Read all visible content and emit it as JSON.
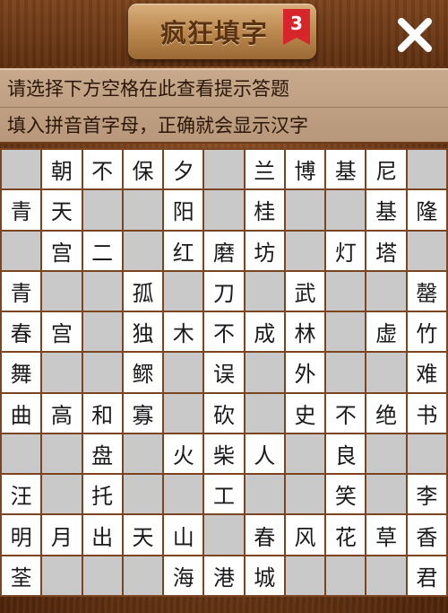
{
  "header": {
    "title": "疯狂填字",
    "level": "3",
    "close_icon": "close-icon"
  },
  "hints": {
    "line1": "请选择下方空格在此查看提示答题",
    "line2": "填入拼音首字母，正确就会显示汉字"
  },
  "colors": {
    "blocked_cell": "#c9c9c9",
    "open_cell": "#ffffff",
    "badge": "#d6262b"
  },
  "grid": {
    "note": "# = blocked, empty string = empty answer cell",
    "rows": [
      [
        "#",
        "朝",
        "不",
        "保",
        "夕",
        "#",
        "兰",
        "博",
        "基",
        "尼",
        "#"
      ],
      [
        "青",
        "天",
        "#",
        "#",
        "阳",
        "#",
        "桂",
        "#",
        "#",
        "基",
        "隆"
      ],
      [
        "#",
        "宫",
        "二",
        "#",
        "红",
        "磨",
        "坊",
        "#",
        "灯",
        "塔",
        "#"
      ],
      [
        "青",
        "#",
        "#",
        "孤",
        "#",
        "刀",
        "#",
        "武",
        "#",
        "#",
        "罄"
      ],
      [
        "春",
        "宫",
        "#",
        "独",
        "木",
        "不",
        "成",
        "林",
        "#",
        "虚",
        "竹"
      ],
      [
        "舞",
        "#",
        "#",
        "鳏",
        "#",
        "误",
        "#",
        "外",
        "#",
        "#",
        "难"
      ],
      [
        "曲",
        "高",
        "和",
        "寡",
        "#",
        "砍",
        "#",
        "史",
        "不",
        "绝",
        "书"
      ],
      [
        "#",
        "#",
        "盘",
        "#",
        "火",
        "柴",
        "人",
        "#",
        "良",
        "#",
        "#"
      ],
      [
        "汪",
        "#",
        "托",
        "#",
        "#",
        "工",
        "#",
        "#",
        "笑",
        "#",
        "李"
      ],
      [
        "明",
        "月",
        "出",
        "天",
        "山",
        "#",
        "春",
        "风",
        "花",
        "草",
        "香"
      ],
      [
        "荃",
        "#",
        "#",
        "#",
        "海",
        "港",
        "城",
        "#",
        "#",
        "#",
        "君"
      ]
    ]
  }
}
